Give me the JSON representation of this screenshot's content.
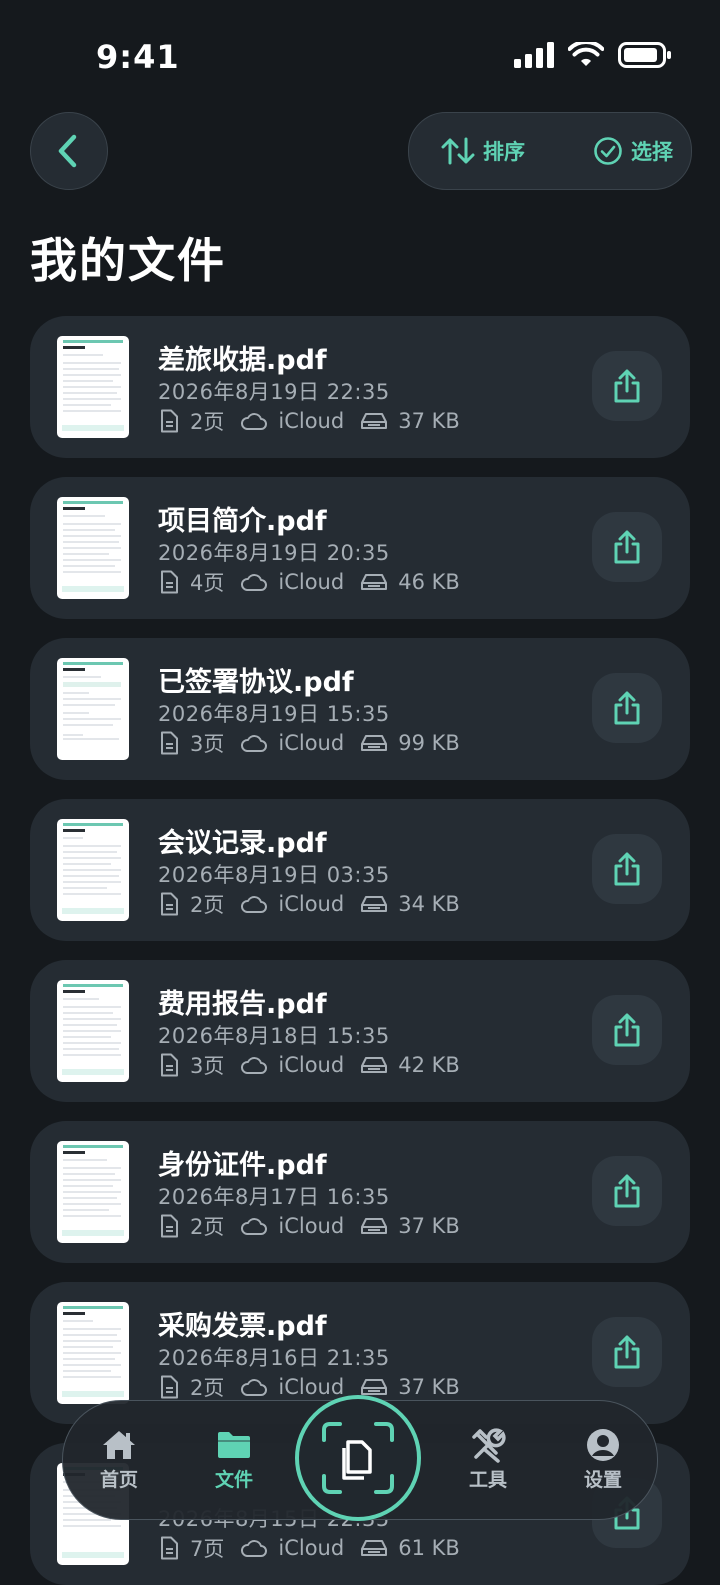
{
  "status_bar": {
    "time": "9:41"
  },
  "header": {
    "back_icon": "chevron-left-icon",
    "sort_label": "排序",
    "select_label": "选择",
    "title": "我的文件"
  },
  "accent_color": "#5fd3b4",
  "files": [
    {
      "name": "差旅收据.pdf",
      "date": "2026年8月19日 22:35",
      "pages": "2页",
      "storage": "iCloud",
      "size": "37 KB"
    },
    {
      "name": "项目简介.pdf",
      "date": "2026年8月19日 20:35",
      "pages": "4页",
      "storage": "iCloud",
      "size": "46 KB"
    },
    {
      "name": "已签署协议.pdf",
      "date": "2026年8月19日 15:35",
      "pages": "3页",
      "storage": "iCloud",
      "size": "99 KB"
    },
    {
      "name": "会议记录.pdf",
      "date": "2026年8月19日 03:35",
      "pages": "2页",
      "storage": "iCloud",
      "size": "34 KB"
    },
    {
      "name": "费用报告.pdf",
      "date": "2026年8月18日 15:35",
      "pages": "3页",
      "storage": "iCloud",
      "size": "42 KB"
    },
    {
      "name": "身份证件.pdf",
      "date": "2026年8月17日 16:35",
      "pages": "2页",
      "storage": "iCloud",
      "size": "37 KB"
    },
    {
      "name": "采购发票.pdf",
      "date": "2026年8月16日 21:35",
      "pages": "2页",
      "storage": "iCloud",
      "size": "37 KB"
    },
    {
      "name": "",
      "date": "2026年8月15日 22:35",
      "pages": "7页",
      "storage": "iCloud",
      "size": "61 KB"
    }
  ],
  "tab_bar": {
    "home": "首页",
    "files": "文件",
    "tools": "工具",
    "settings": "设置",
    "active": "files"
  }
}
